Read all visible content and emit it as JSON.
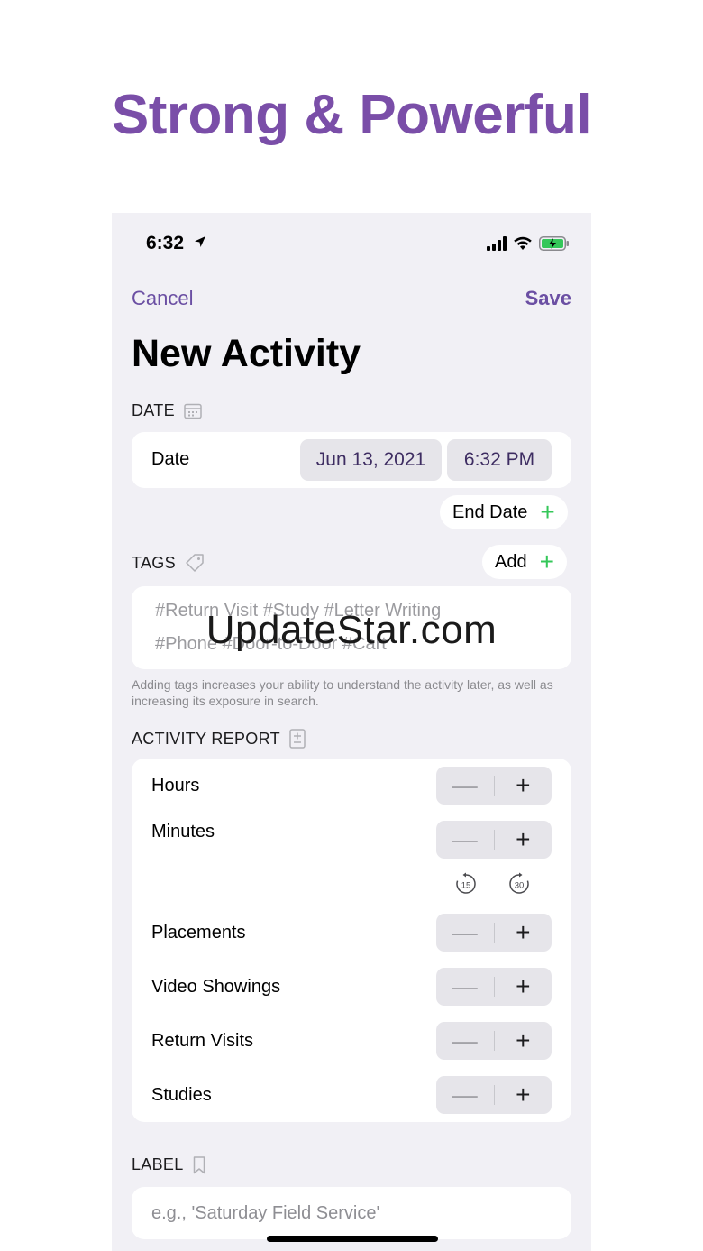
{
  "headline": "Strong & Powerful",
  "status_bar": {
    "time": "6:32"
  },
  "nav": {
    "cancel": "Cancel",
    "save": "Save"
  },
  "title": "New Activity",
  "date_section": {
    "header": "DATE",
    "row_label": "Date",
    "date_value": "Jun 13, 2021",
    "time_value": "6:32 PM",
    "end_date_label": "End Date"
  },
  "tags_section": {
    "header": "TAGS",
    "add_label": "Add",
    "placeholder_line1": "#Return Visit  #Study  #Letter Writing",
    "placeholder_line2": "#Phone  #Door-to-Door  #Cart",
    "helper_text": "Adding tags increases your ability to understand the activity later, as well as increasing its exposure in search."
  },
  "activity_report": {
    "header": "ACTIVITY REPORT",
    "rows": [
      {
        "label": "Hours"
      },
      {
        "label": "Minutes"
      },
      {
        "label": "Placements"
      },
      {
        "label": "Video Showings"
      },
      {
        "label": "Return Visits"
      },
      {
        "label": "Studies"
      }
    ],
    "skip_15": "15",
    "skip_30": "30",
    "minus_symbol": "—",
    "plus_symbol": "+"
  },
  "label_section": {
    "header": "LABEL",
    "placeholder": "e.g., 'Saturday Field Service'"
  },
  "watermark": "UpdateStar.com",
  "colors": {
    "accent": "#6b4fa3",
    "headline": "#7a4ea8",
    "green": "#34c759",
    "background": "#f1f0f5"
  }
}
